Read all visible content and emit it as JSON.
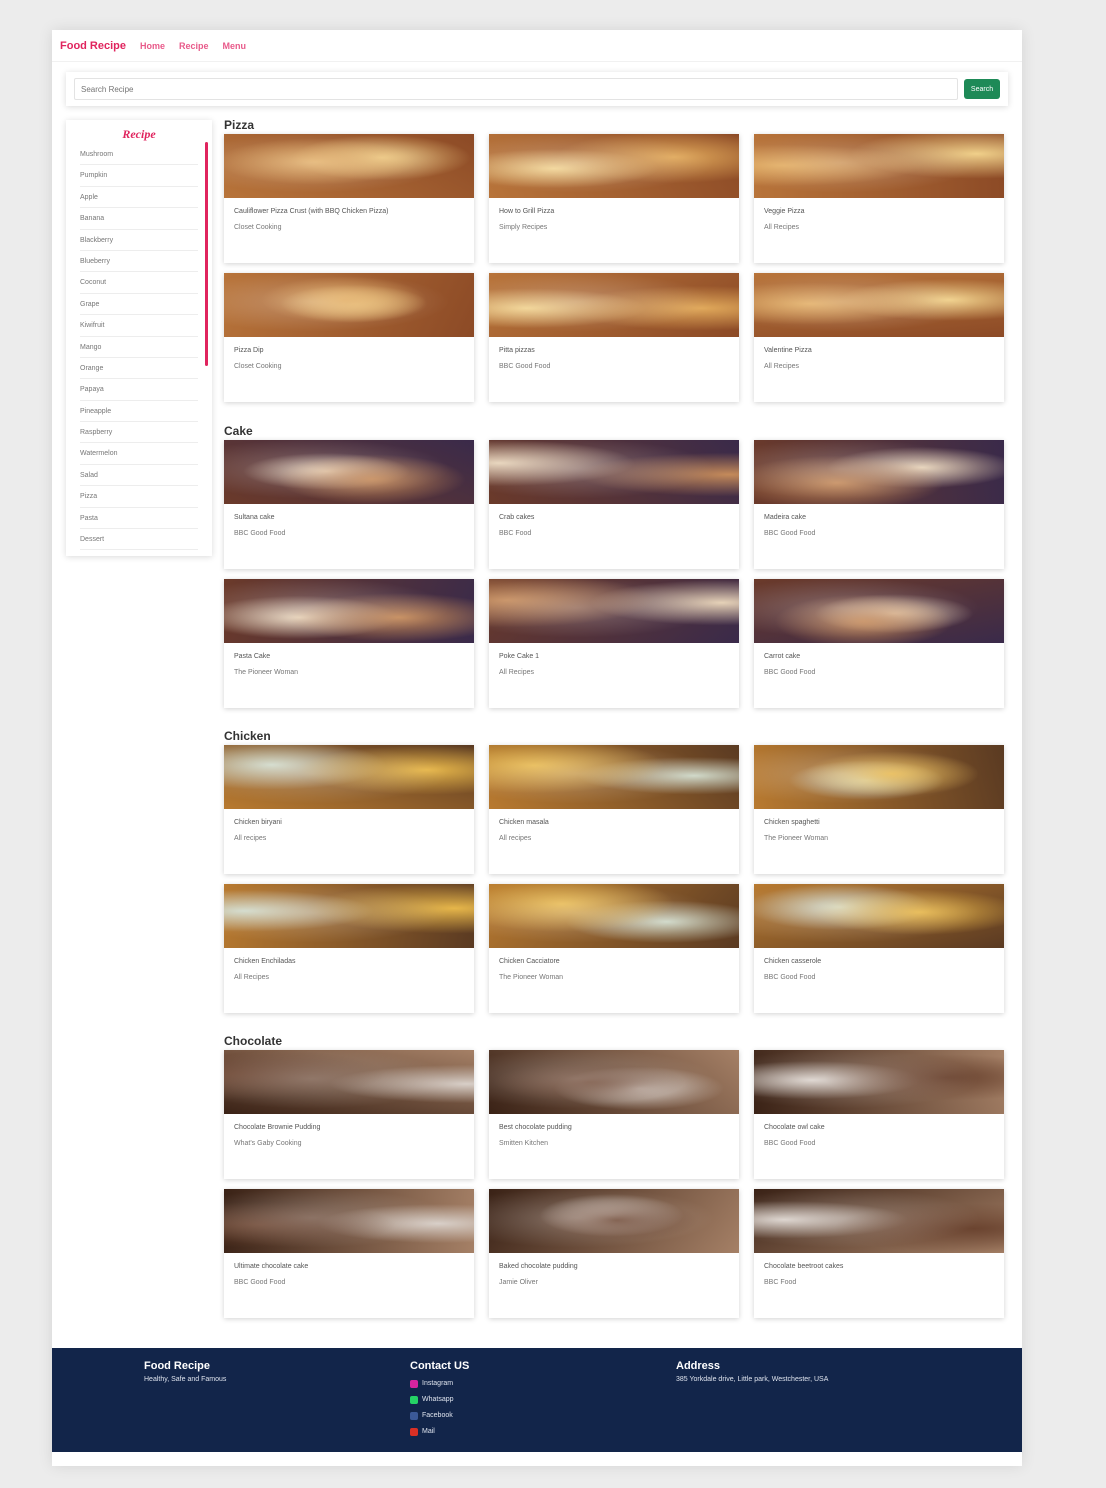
{
  "nav": {
    "brand": "Food Recipe",
    "links": [
      "Home",
      "Recipe",
      "Menu"
    ]
  },
  "search": {
    "placeholder": "Search Recipe",
    "button": "Search"
  },
  "sidebar": {
    "title": "Recipe",
    "items": [
      "Mushroom",
      "Pumpkin",
      "Apple",
      "Banana",
      "Blackberry",
      "Blueberry",
      "Coconut",
      "Grape",
      "Kiwifruit",
      "Mango",
      "Orange",
      "Papaya",
      "Pineapple",
      "Raspberry",
      "Watermelon",
      "Salad",
      "Pizza",
      "Pasta",
      "Dessert"
    ]
  },
  "sections": [
    {
      "title": "Pizza",
      "cards": [
        {
          "title": "Cauliflower Pizza Crust (with BBQ Chicken Pizza)",
          "source": "Closet Cooking",
          "image": "pizza-image"
        },
        {
          "title": "How to Grill Pizza",
          "source": "Simply Recipes",
          "image": "pizza-image"
        },
        {
          "title": "Veggie Pizza",
          "source": "All Recipes",
          "image": "pizza-image"
        },
        {
          "title": "Pizza Dip",
          "source": "Closet Cooking",
          "image": "pizza-image"
        },
        {
          "title": "Pitta pizzas",
          "source": "BBC Good Food",
          "image": "pizza-image"
        },
        {
          "title": "Valentine Pizza",
          "source": "All Recipes",
          "image": "pizza-image"
        }
      ]
    },
    {
      "title": "Cake",
      "cards": [
        {
          "title": "Sultana cake",
          "source": "BBC Good Food",
          "image": "cake-image"
        },
        {
          "title": "Crab cakes",
          "source": "BBC Food",
          "image": "cake-image"
        },
        {
          "title": "Madeira cake",
          "source": "BBC Good Food",
          "image": "cake-image"
        },
        {
          "title": "Pasta Cake",
          "source": "The Pioneer Woman",
          "image": "cake-image"
        },
        {
          "title": "Poke Cake 1",
          "source": "All Recipes",
          "image": "cake-image"
        },
        {
          "title": "Carrot cake",
          "source": "BBC Good Food",
          "image": "cake-image"
        }
      ]
    },
    {
      "title": "Chicken",
      "cards": [
        {
          "title": "Chicken biryani",
          "source": "All recipes",
          "image": "chicken-image"
        },
        {
          "title": "Chicken masala",
          "source": "All recipes",
          "image": "chicken-image"
        },
        {
          "title": "Chicken spaghetti",
          "source": "The Pioneer Woman",
          "image": "chicken-image"
        },
        {
          "title": "Chicken Enchiladas",
          "source": "All Recipes",
          "image": "chicken-image"
        },
        {
          "title": "Chicken Cacciatore",
          "source": "The Pioneer Woman",
          "image": "chicken-image"
        },
        {
          "title": "Chicken casserole",
          "source": "BBC Good Food",
          "image": "chicken-image"
        }
      ]
    },
    {
      "title": "Chocolate",
      "cards": [
        {
          "title": "Chocolate Brownie Pudding",
          "source": "What's Gaby Cooking",
          "image": "chocolate-image"
        },
        {
          "title": "Best chocolate pudding",
          "source": "Smitten Kitchen",
          "image": "chocolate-image"
        },
        {
          "title": "Chocolate owl cake",
          "source": "BBC Good Food",
          "image": "chocolate-image"
        },
        {
          "title": "Ultimate chocolate cake",
          "source": "BBC Good Food",
          "image": "chocolate-image"
        },
        {
          "title": "Baked chocolate pudding",
          "source": "Jamie Oliver",
          "image": "chocolate-image"
        },
        {
          "title": "Chocolate beetroot cakes",
          "source": "BBC Food",
          "image": "chocolate-image"
        }
      ]
    }
  ],
  "footer": {
    "brand": "Food Recipe",
    "tagline": "Healthy, Safe and Famous",
    "contact_head": "Contact US",
    "contacts": [
      {
        "label": "Instagram",
        "icon": "instagram-icon",
        "color": "#d6249f"
      },
      {
        "label": "Whatsapp",
        "icon": "whatsapp-icon",
        "color": "#25d366"
      },
      {
        "label": "Facebook",
        "icon": "facebook-icon",
        "color": "#3b5998"
      },
      {
        "label": "Mail",
        "icon": "mail-icon",
        "color": "#d93025"
      }
    ],
    "address_head": "Address",
    "address": "385 Yorkdale drive, Little park, Westchester, USA"
  },
  "colors": {
    "accent": "#e0245e",
    "search_button": "#1e8a57",
    "footer_bg": "#12254a"
  }
}
